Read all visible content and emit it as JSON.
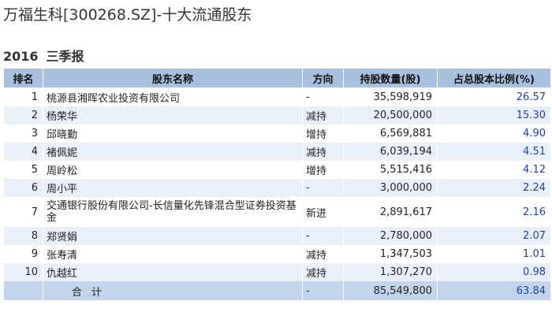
{
  "title": "万福生科[300268.SZ]-十大流通股东",
  "period": {
    "year": "2016",
    "quarter": "三季报"
  },
  "table": {
    "headers": [
      "排名",
      "股东名称",
      "方向",
      "持股数量(股)",
      "占总股本比例(%)"
    ],
    "rows": [
      {
        "rank": "1",
        "name": "桃源县湘晖农业投资有限公司",
        "direction": "-",
        "shares": "35,598,919",
        "ratio": "26.57"
      },
      {
        "rank": "2",
        "name": "杨荣华",
        "direction": "减持",
        "shares": "20,500,000",
        "ratio": "15.30"
      },
      {
        "rank": "3",
        "name": "邱晓勤",
        "direction": "增持",
        "shares": "6,569,881",
        "ratio": "4.90"
      },
      {
        "rank": "4",
        "name": "褚佩妮",
        "direction": "减持",
        "shares": "6,039,194",
        "ratio": "4.51"
      },
      {
        "rank": "5",
        "name": "周岭松",
        "direction": "增持",
        "shares": "5,515,416",
        "ratio": "4.12"
      },
      {
        "rank": "6",
        "name": "周小平",
        "direction": "-",
        "shares": "3,000,000",
        "ratio": "2.24"
      },
      {
        "rank": "7",
        "name": "交通银行股份有限公司-长信量化先锋混合型证券投资基金",
        "direction": "新进",
        "shares": "2,891,617",
        "ratio": "2.16"
      },
      {
        "rank": "8",
        "name": "郑贤娟",
        "direction": "-",
        "shares": "2,780,000",
        "ratio": "2.07"
      },
      {
        "rank": "9",
        "name": "张寿清",
        "direction": "减持",
        "shares": "1,347,503",
        "ratio": "1.01"
      },
      {
        "rank": "10",
        "name": "仇越红",
        "direction": "减持",
        "shares": "1,307,270",
        "ratio": "0.98"
      }
    ],
    "total": {
      "label": "合计",
      "direction": "-",
      "shares": "85,549,800",
      "ratio": "63.84"
    }
  }
}
